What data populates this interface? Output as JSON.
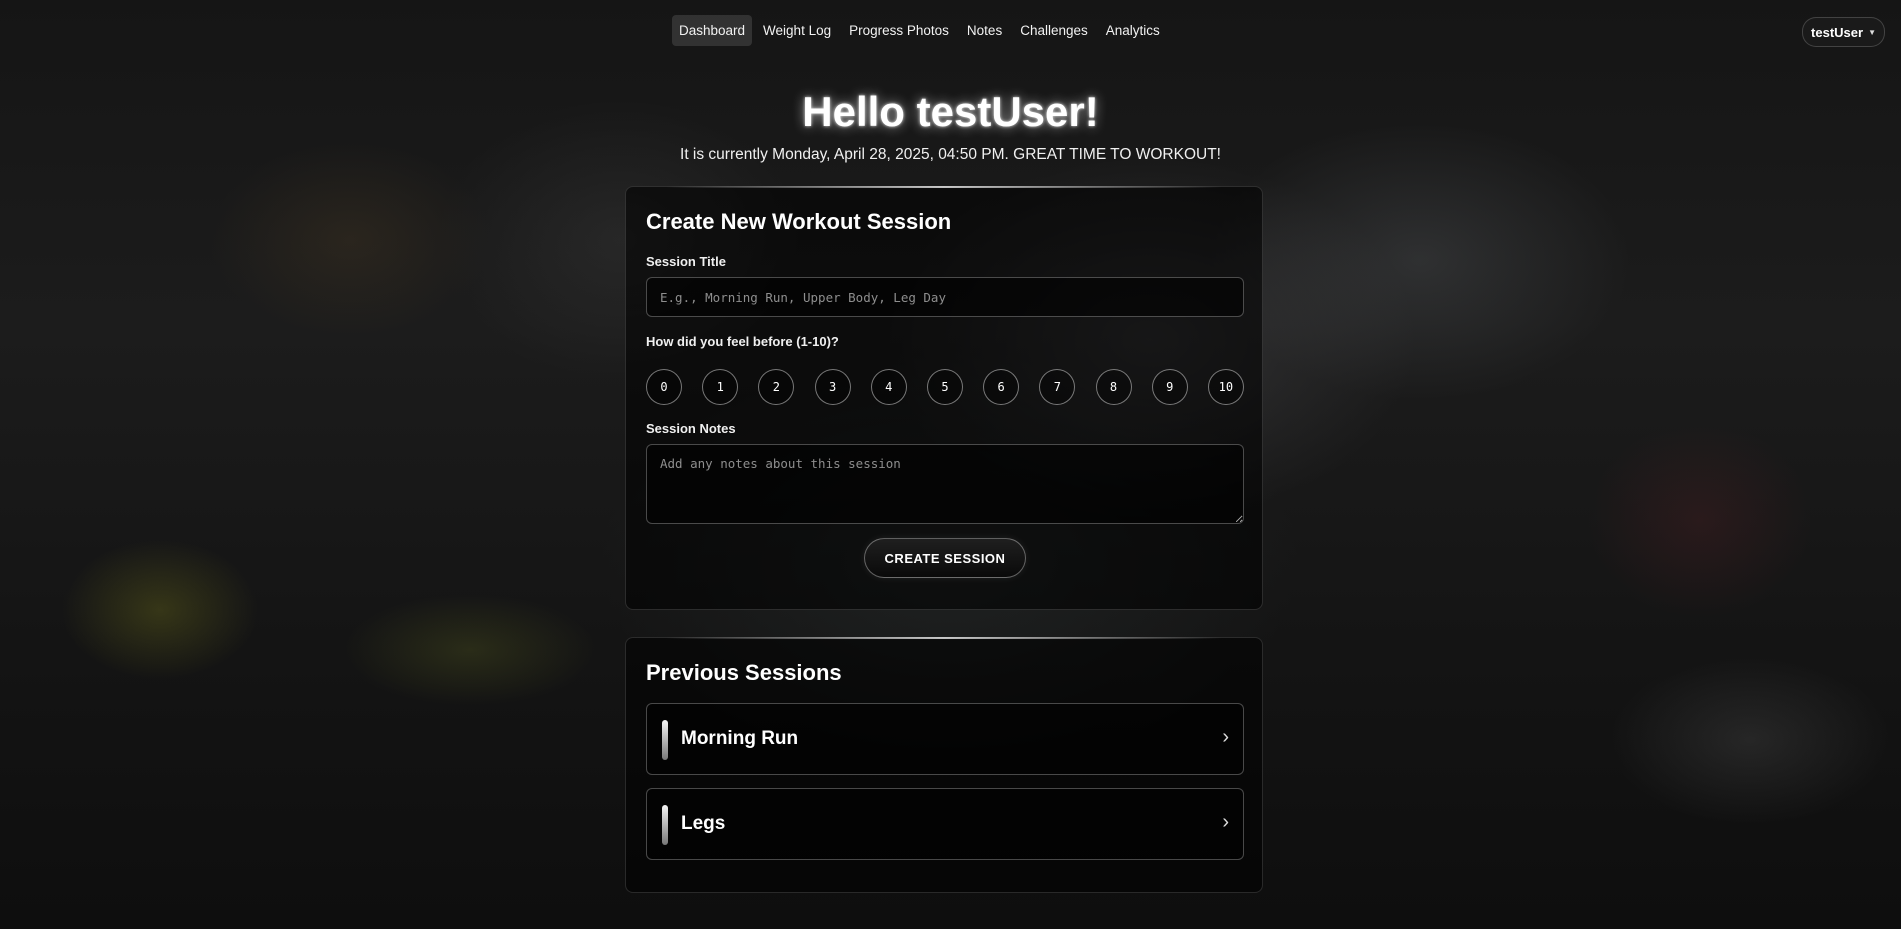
{
  "nav": {
    "items": [
      {
        "label": "Dashboard",
        "active": true
      },
      {
        "label": "Weight Log",
        "active": false
      },
      {
        "label": "Progress Photos",
        "active": false
      },
      {
        "label": "Notes",
        "active": false
      },
      {
        "label": "Challenges",
        "active": false
      },
      {
        "label": "Analytics",
        "active": false
      }
    ],
    "user": "testUser"
  },
  "hero": {
    "greeting": "Hello testUser!",
    "subline": "It is currently Monday, April 28, 2025, 04:50 PM. GREAT TIME TO WORKOUT!"
  },
  "create_session": {
    "title": "Create New Workout Session",
    "session_title_label": "Session Title",
    "session_title_placeholder": "E.g., Morning Run, Upper Body, Leg Day",
    "session_title_value": "",
    "feel_label": "How did you feel before (1-10)?",
    "ratings": [
      "0",
      "1",
      "2",
      "3",
      "4",
      "5",
      "6",
      "7",
      "8",
      "9",
      "10"
    ],
    "notes_label": "Session Notes",
    "notes_placeholder": "Add any notes about this session",
    "notes_value": "",
    "button_label": "CREATE SESSION"
  },
  "previous_sessions": {
    "title": "Previous Sessions",
    "items": [
      {
        "name": "Morning Run",
        "icon": "chevron-right-icon"
      },
      {
        "name": "Legs",
        "icon": "chevron-right-icon"
      }
    ]
  },
  "colors": {
    "accent": "#ffffff",
    "card_background": "#000000",
    "page_background": "#1a1a1a"
  }
}
